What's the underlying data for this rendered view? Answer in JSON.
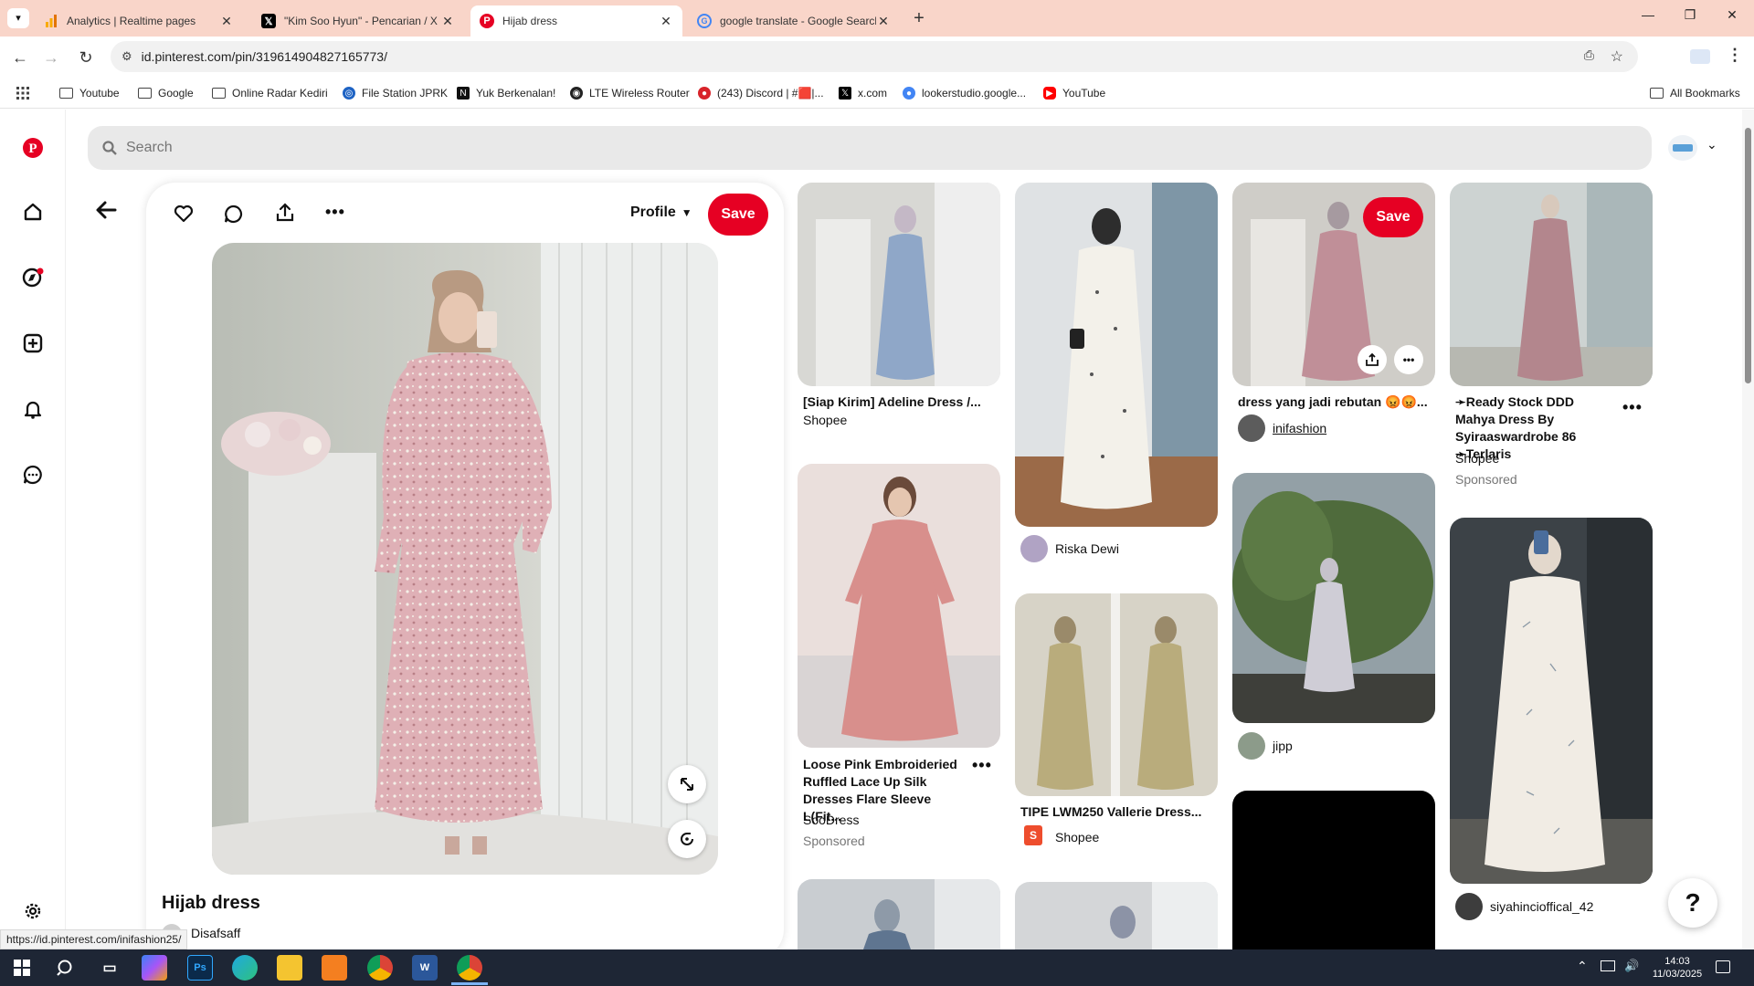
{
  "browser": {
    "tabs": [
      {
        "title": "Analytics | Realtime pages",
        "icon": "analytics-icon"
      },
      {
        "title": "\"Kim Soo Hyun\" - Pencarian / X",
        "icon": "x-icon"
      },
      {
        "title": "Hijab dress",
        "icon": "pinterest-icon",
        "active": true
      },
      {
        "title": "google translate - Google Search",
        "icon": "google-icon"
      }
    ],
    "url": "id.pinterest.com/pin/319614904827165773/",
    "bookmarks": [
      {
        "label": "Youtube",
        "icon": "folder-icon"
      },
      {
        "label": "Google",
        "icon": "folder-icon"
      },
      {
        "label": "Online Radar Kediri",
        "icon": "folder-icon"
      },
      {
        "label": "File Station JPRK",
        "icon": "file-station-icon"
      },
      {
        "label": "Yuk Berkenalan!",
        "icon": "notion-icon"
      },
      {
        "label": "LTE Wireless Router",
        "icon": "router-icon"
      },
      {
        "label": "(243) Discord | #🟥|...",
        "icon": "discord-icon"
      },
      {
        "label": "x.com",
        "icon": "x-icon"
      },
      {
        "label": "lookerstudio.google...",
        "icon": "looker-icon"
      },
      {
        "label": "YouTube",
        "icon": "youtube-icon"
      }
    ],
    "all_bookmarks": "All Bookmarks",
    "status_url": "https://id.pinterest.com/inifashion25/"
  },
  "search": {
    "placeholder": "Search"
  },
  "pin": {
    "profile_label": "Profile",
    "save_label": "Save",
    "title": "Hijab dress",
    "author": "Disafsaff"
  },
  "feed": {
    "save_label": "Save",
    "cards": [
      {
        "title": "[Siap Kirim] Adeline Dress /...",
        "source": "Shopee"
      },
      {
        "title": "Loose Pink Embroideried Ruffled Lace Up Silk Dresses Flare Sleeve L(Fit...",
        "source": "SooDress",
        "sponsored": "Sponsored"
      },
      {
        "user": "Riska Dewi"
      },
      {
        "title": "TIPE LWM250 Vallerie Dress...",
        "source": "Shopee"
      },
      {
        "title": "dress yang jadi rebutan 😡😡...",
        "user": "inifashion"
      },
      {
        "user": "jipp"
      },
      {
        "title": "➛Ready Stock DDD Mahya Dress By Syiraaswardrobe 86 ➛Terlaris",
        "source": "Shopee",
        "sponsored": "Sponsored"
      },
      {
        "user": "siyahincioffical_42"
      }
    ]
  },
  "help_label": "?",
  "taskbar": {
    "time": "14:03",
    "date": "11/03/2025"
  },
  "colors": {
    "accent": "#e60023",
    "tabstrip": "#f9d5c9",
    "taskbar": "#1e2635"
  }
}
